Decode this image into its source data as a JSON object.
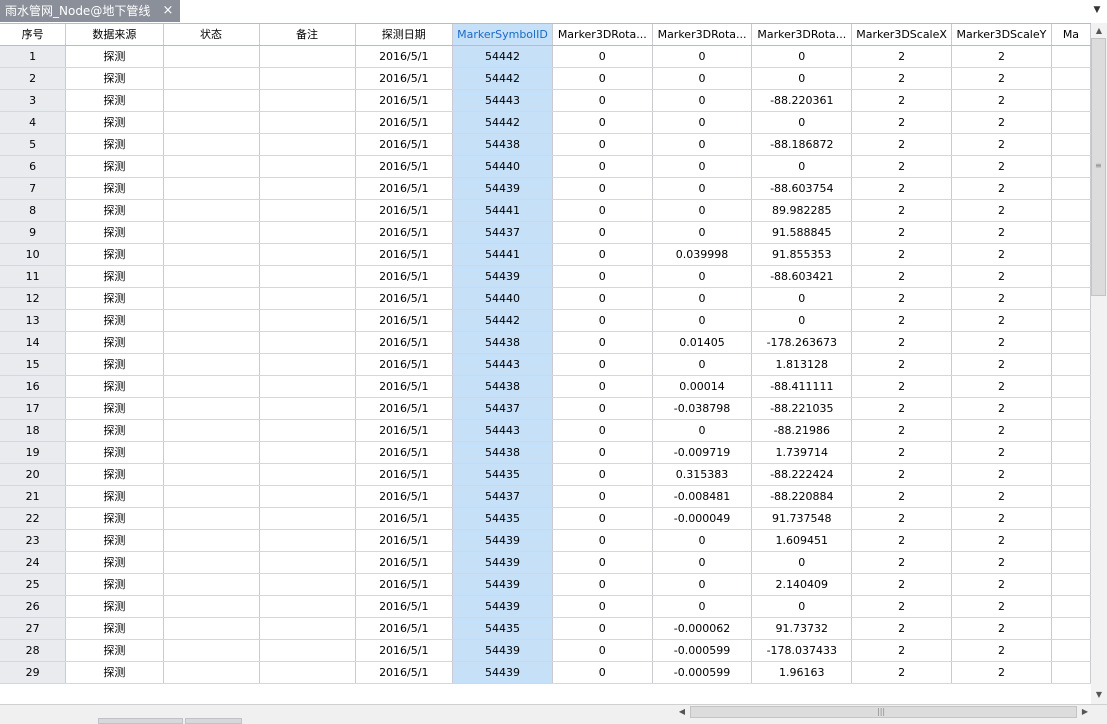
{
  "tab": {
    "title": "雨水管网_Node@地下管线",
    "close_glyph": "×",
    "menu_glyph": "▼"
  },
  "columns": [
    "序号",
    "数据来源",
    "状态",
    "备注",
    "探测日期",
    "MarkerSymbolID",
    "Marker3DRota...",
    "Marker3DRota...",
    "Marker3DRota...",
    "Marker3DScaleX",
    "Marker3DScaleY",
    "Ma"
  ],
  "highlighted_column": "MarkerSymbolID",
  "rows": [
    [
      "1",
      "探测",
      "",
      "",
      "2016/5/1",
      "54442",
      "0",
      "0",
      "0",
      "2",
      "2",
      ""
    ],
    [
      "2",
      "探测",
      "",
      "",
      "2016/5/1",
      "54442",
      "0",
      "0",
      "0",
      "2",
      "2",
      ""
    ],
    [
      "3",
      "探测",
      "",
      "",
      "2016/5/1",
      "54443",
      "0",
      "0",
      "-88.220361",
      "2",
      "2",
      ""
    ],
    [
      "4",
      "探测",
      "",
      "",
      "2016/5/1",
      "54442",
      "0",
      "0",
      "0",
      "2",
      "2",
      ""
    ],
    [
      "5",
      "探测",
      "",
      "",
      "2016/5/1",
      "54438",
      "0",
      "0",
      "-88.186872",
      "2",
      "2",
      ""
    ],
    [
      "6",
      "探测",
      "",
      "",
      "2016/5/1",
      "54440",
      "0",
      "0",
      "0",
      "2",
      "2",
      ""
    ],
    [
      "7",
      "探测",
      "",
      "",
      "2016/5/1",
      "54439",
      "0",
      "0",
      "-88.603754",
      "2",
      "2",
      ""
    ],
    [
      "8",
      "探测",
      "",
      "",
      "2016/5/1",
      "54441",
      "0",
      "0",
      "89.982285",
      "2",
      "2",
      ""
    ],
    [
      "9",
      "探测",
      "",
      "",
      "2016/5/1",
      "54437",
      "0",
      "0",
      "91.588845",
      "2",
      "2",
      ""
    ],
    [
      "10",
      "探测",
      "",
      "",
      "2016/5/1",
      "54441",
      "0",
      "0.039998",
      "91.855353",
      "2",
      "2",
      ""
    ],
    [
      "11",
      "探测",
      "",
      "",
      "2016/5/1",
      "54439",
      "0",
      "0",
      "-88.603421",
      "2",
      "2",
      ""
    ],
    [
      "12",
      "探测",
      "",
      "",
      "2016/5/1",
      "54440",
      "0",
      "0",
      "0",
      "2",
      "2",
      ""
    ],
    [
      "13",
      "探测",
      "",
      "",
      "2016/5/1",
      "54442",
      "0",
      "0",
      "0",
      "2",
      "2",
      ""
    ],
    [
      "14",
      "探测",
      "",
      "",
      "2016/5/1",
      "54438",
      "0",
      "0.01405",
      "-178.263673",
      "2",
      "2",
      ""
    ],
    [
      "15",
      "探测",
      "",
      "",
      "2016/5/1",
      "54443",
      "0",
      "0",
      "1.813128",
      "2",
      "2",
      ""
    ],
    [
      "16",
      "探测",
      "",
      "",
      "2016/5/1",
      "54438",
      "0",
      "0.00014",
      "-88.411111",
      "2",
      "2",
      ""
    ],
    [
      "17",
      "探测",
      "",
      "",
      "2016/5/1",
      "54437",
      "0",
      "-0.038798",
      "-88.221035",
      "2",
      "2",
      ""
    ],
    [
      "18",
      "探测",
      "",
      "",
      "2016/5/1",
      "54443",
      "0",
      "0",
      "-88.21986",
      "2",
      "2",
      ""
    ],
    [
      "19",
      "探测",
      "",
      "",
      "2016/5/1",
      "54438",
      "0",
      "-0.009719",
      "1.739714",
      "2",
      "2",
      ""
    ],
    [
      "20",
      "探测",
      "",
      "",
      "2016/5/1",
      "54435",
      "0",
      "0.315383",
      "-88.222424",
      "2",
      "2",
      ""
    ],
    [
      "21",
      "探测",
      "",
      "",
      "2016/5/1",
      "54437",
      "0",
      "-0.008481",
      "-88.220884",
      "2",
      "2",
      ""
    ],
    [
      "22",
      "探测",
      "",
      "",
      "2016/5/1",
      "54435",
      "0",
      "-0.000049",
      "91.737548",
      "2",
      "2",
      ""
    ],
    [
      "23",
      "探测",
      "",
      "",
      "2016/5/1",
      "54439",
      "0",
      "0",
      "1.609451",
      "2",
      "2",
      ""
    ],
    [
      "24",
      "探测",
      "",
      "",
      "2016/5/1",
      "54439",
      "0",
      "0",
      "0",
      "2",
      "2",
      ""
    ],
    [
      "25",
      "探测",
      "",
      "",
      "2016/5/1",
      "54439",
      "0",
      "0",
      "2.140409",
      "2",
      "2",
      ""
    ],
    [
      "26",
      "探测",
      "",
      "",
      "2016/5/1",
      "54439",
      "0",
      "0",
      "0",
      "2",
      "2",
      ""
    ],
    [
      "27",
      "探测",
      "",
      "",
      "2016/5/1",
      "54435",
      "0",
      "-0.000062",
      "91.73732",
      "2",
      "2",
      ""
    ],
    [
      "28",
      "探测",
      "",
      "",
      "2016/5/1",
      "54439",
      "0",
      "-0.000599",
      "-178.037433",
      "2",
      "2",
      ""
    ],
    [
      "29",
      "探测",
      "",
      "",
      "2016/5/1",
      "54439",
      "0",
      "-0.000599",
      "1.96163",
      "2",
      "2",
      ""
    ]
  ],
  "scrollbar": {
    "up": "▲",
    "down": "▼",
    "left": "◀",
    "right": "▶",
    "grip_v": "≡",
    "grip_h": "|||"
  },
  "colors": {
    "tab_bg": "#8a8f99",
    "highlight": "#c6e0f8",
    "seq_bg": "#e9ebee"
  }
}
